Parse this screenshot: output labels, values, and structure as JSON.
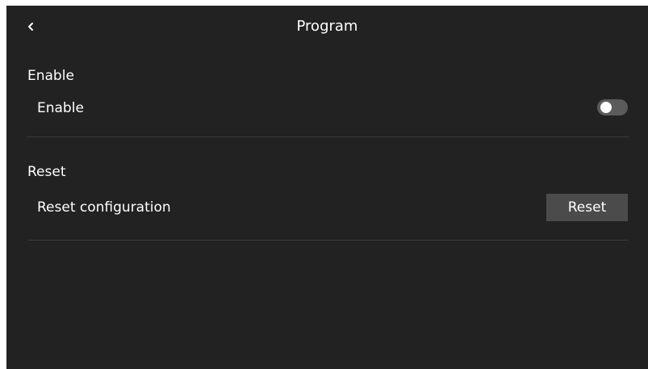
{
  "header": {
    "back_icon": "chevron-left-icon",
    "title": "Program"
  },
  "sections": {
    "enable": {
      "title": "Enable",
      "row_label": "Enable",
      "toggle_on": false
    },
    "reset": {
      "title": "Reset",
      "row_label": "Reset configuration",
      "button_label": "Reset"
    }
  },
  "colors": {
    "background": "#222222",
    "text": "#ffffff",
    "divider": "#3c3c3c",
    "button_bg": "#4b4b4b",
    "toggle_off_track": "#5b5b5b"
  }
}
